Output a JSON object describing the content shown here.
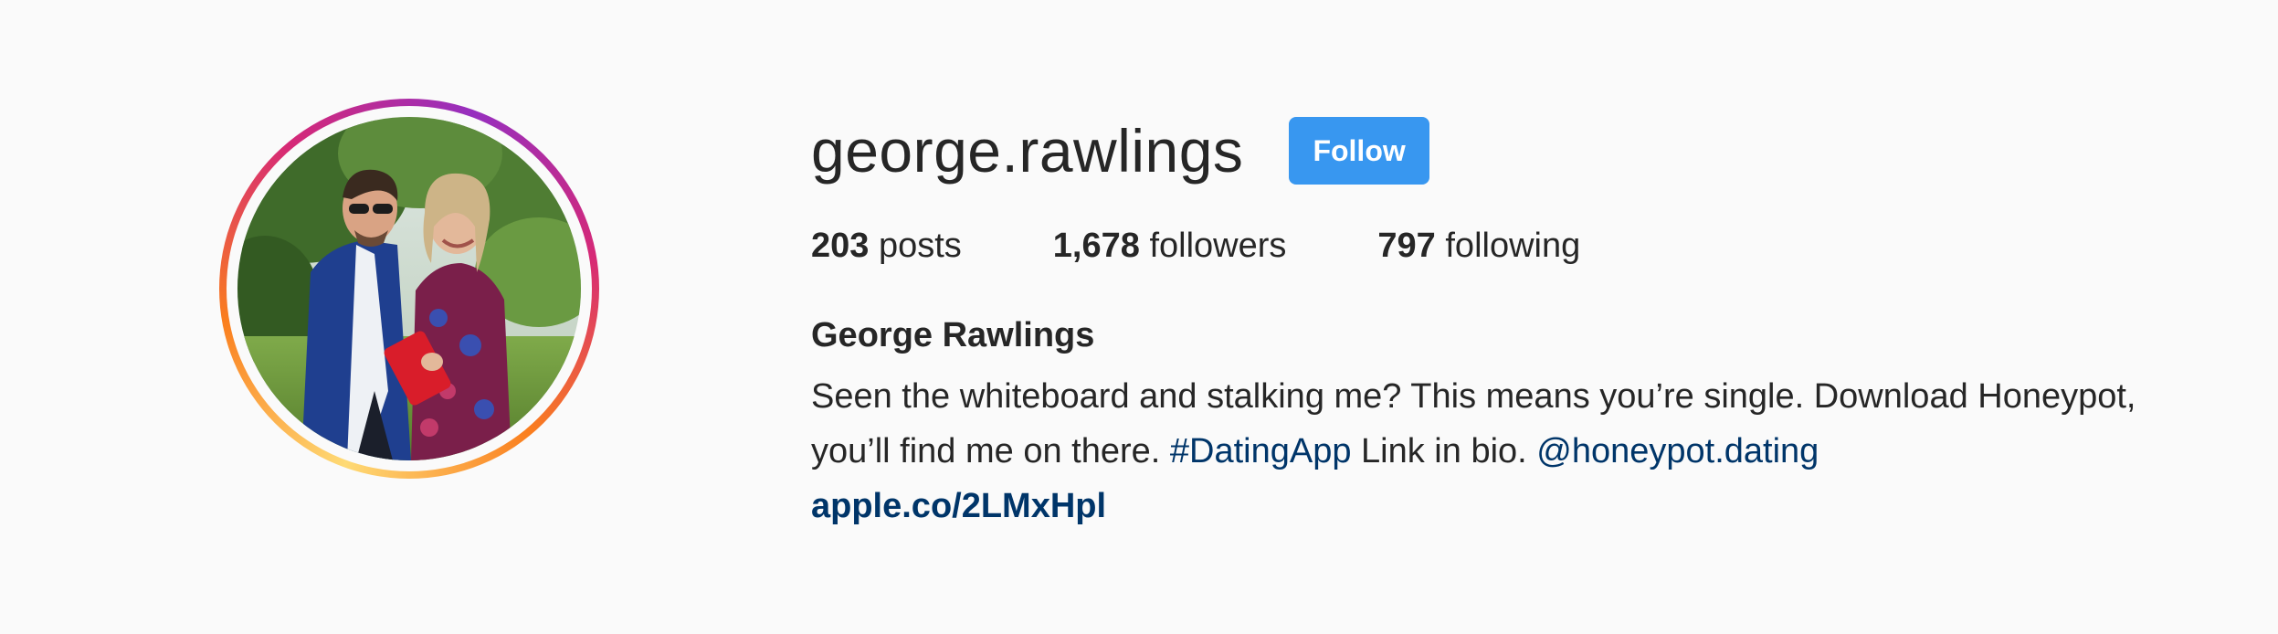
{
  "profile": {
    "username": "george.rawlings",
    "follow_label": "Follow",
    "stats": {
      "posts_count": "203",
      "posts_label": "posts",
      "followers_count": "1,678",
      "followers_label": "followers",
      "following_count": "797",
      "following_label": "following"
    },
    "full_name": "George Rawlings",
    "bio": {
      "line1": "Seen the whiteboard and stalking me? This means you’re single. Download Honeypot,",
      "line2_prefix": "you’ll find me on there. ",
      "hashtag": "#DatingApp",
      "line2_middle": " Link in bio. ",
      "mention": "@honeypot.dating"
    },
    "website": "apple.co/2LMxHpl"
  },
  "colors": {
    "follow_button": "#3897f0",
    "link": "#003569",
    "background": "#fafafa",
    "text": "#262626"
  }
}
